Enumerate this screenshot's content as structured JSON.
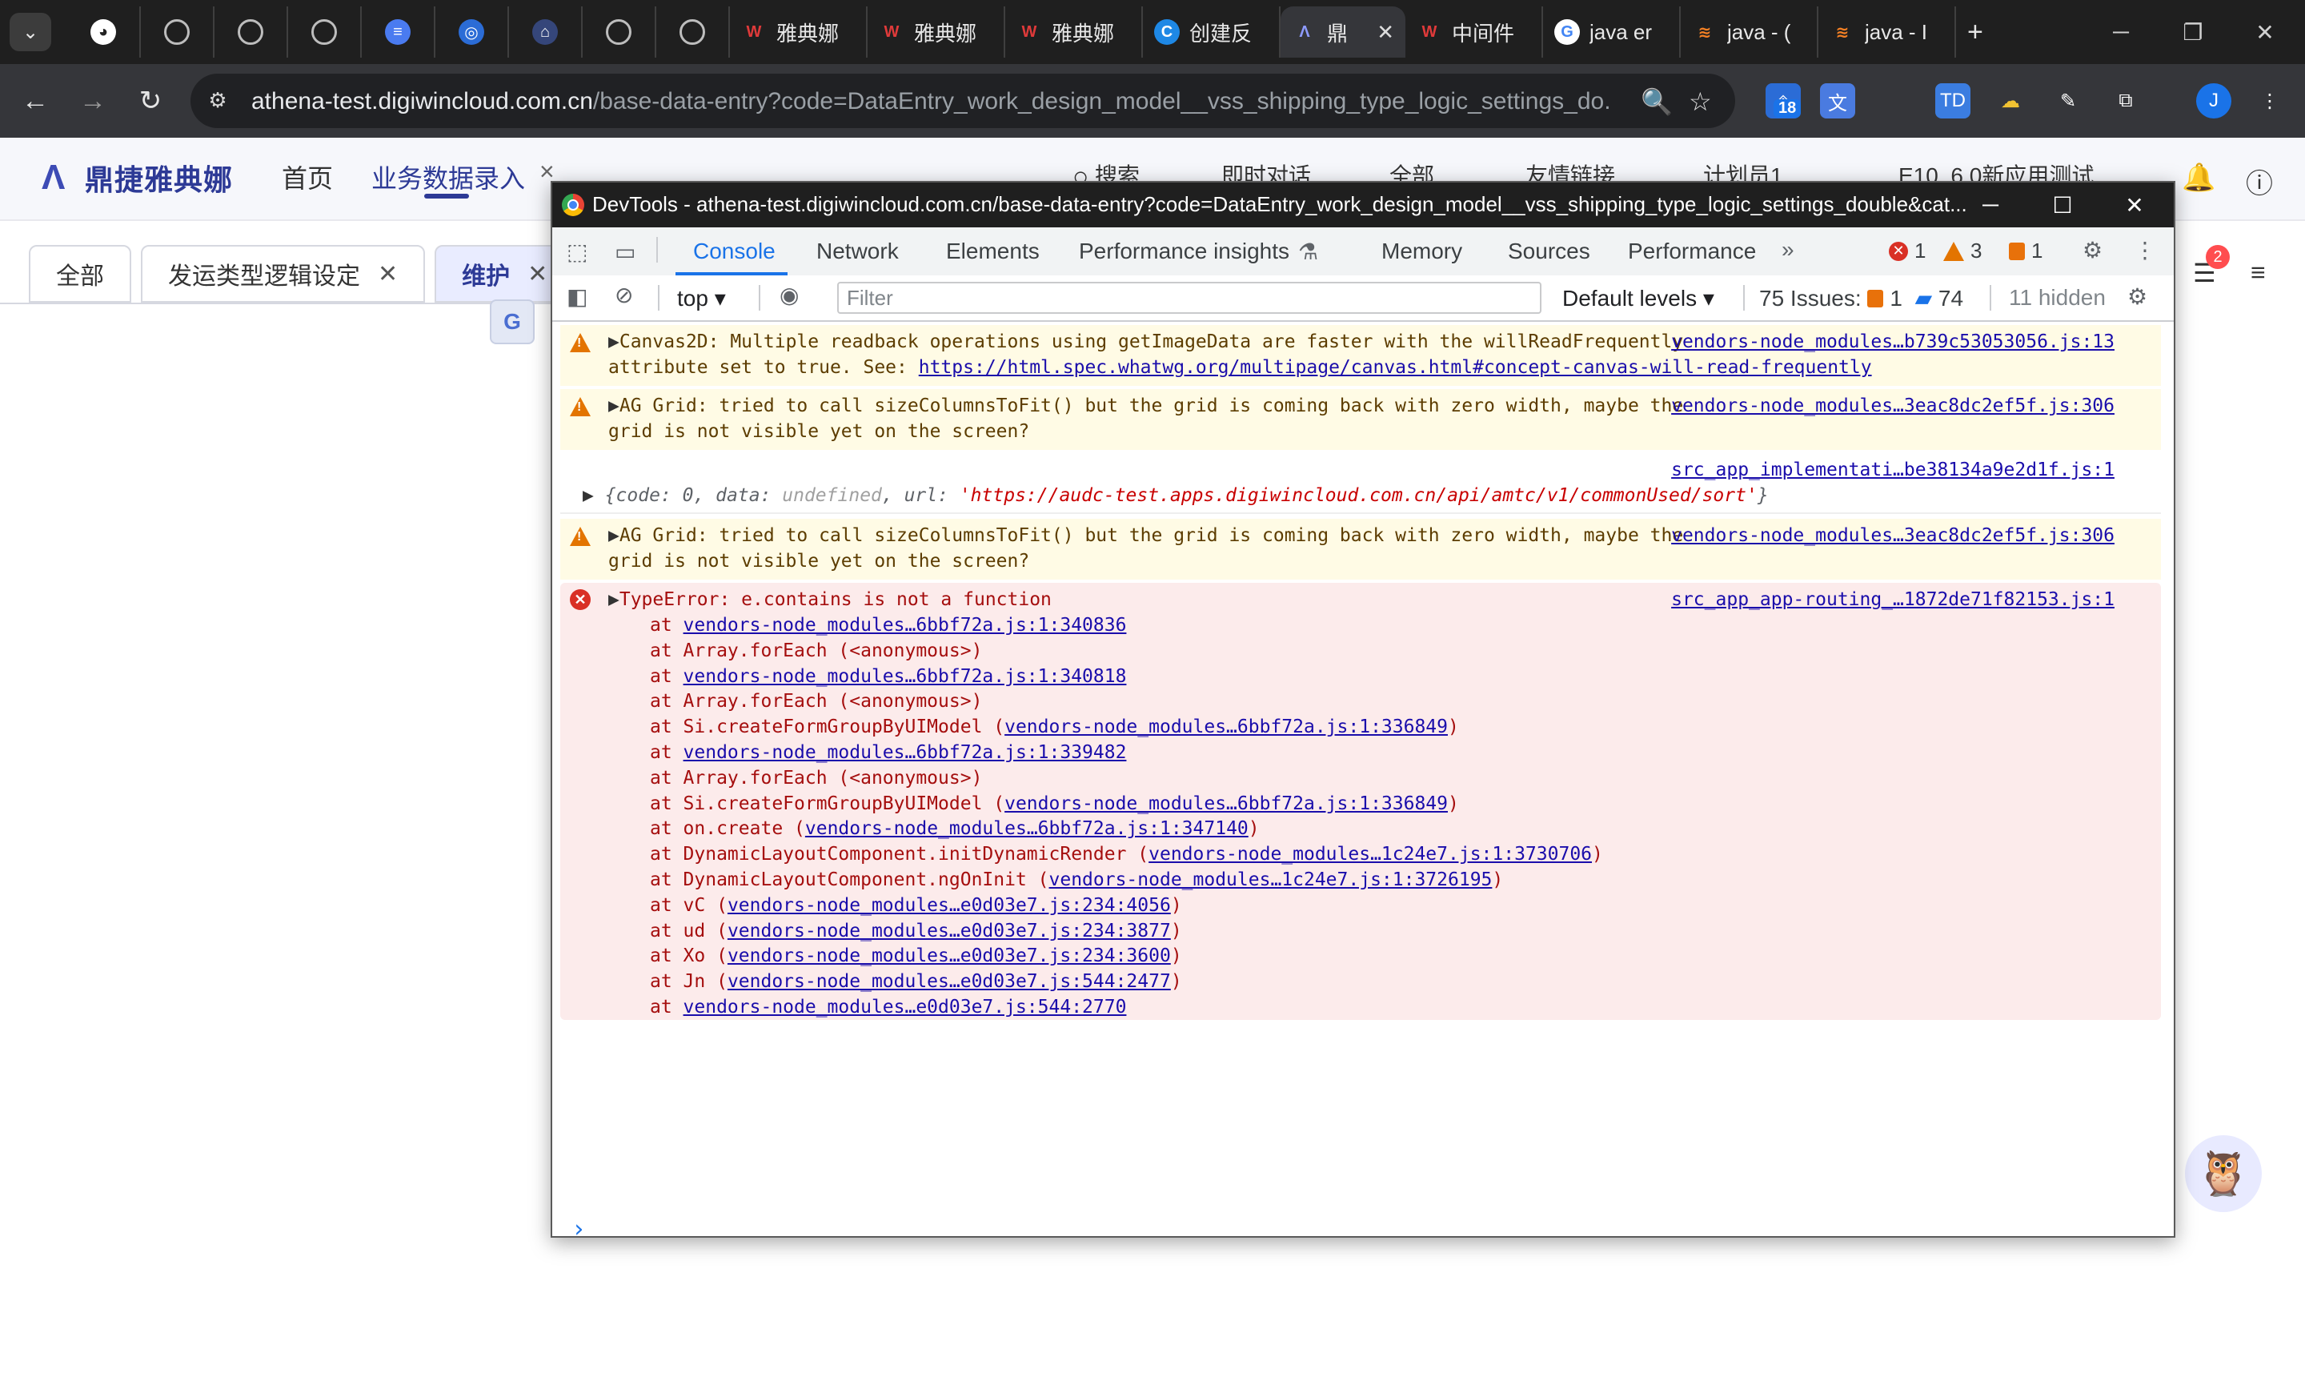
{
  "browser": {
    "tabs": [
      {
        "icon": "ai-icon",
        "title": ""
      },
      {
        "icon": "globe-icon",
        "title": ""
      },
      {
        "icon": "globe-icon",
        "title": ""
      },
      {
        "icon": "globe-icon",
        "title": ""
      },
      {
        "icon": "doc-icon",
        "title": ""
      },
      {
        "icon": "wifi-icon",
        "title": ""
      },
      {
        "icon": "app-icon",
        "title": ""
      },
      {
        "icon": "globe-icon",
        "title": ""
      },
      {
        "icon": "globe-icon",
        "title": ""
      },
      {
        "icon": "yadian-icon",
        "title": "雅典娜"
      },
      {
        "icon": "yadian-icon",
        "title": "雅典娜"
      },
      {
        "icon": "yadian-icon",
        "title": "雅典娜"
      },
      {
        "icon": "create-icon",
        "title": "创建反"
      },
      {
        "icon": "athena-icon",
        "title": "鼎",
        "active": true
      },
      {
        "icon": "yadian-icon",
        "title": "中间件"
      },
      {
        "icon": "google-icon",
        "title": "java er"
      },
      {
        "icon": "stack-icon",
        "title": "java - ("
      },
      {
        "icon": "stack-icon",
        "title": "java - I"
      }
    ],
    "new_tab": "+",
    "url_host": "athena-test.digiwincloud.com.cn",
    "url_path": "/base-data-entry?code=DataEntry_work_design_model__vss_shipping_type_logic_settings_do...",
    "ext_badge": "18",
    "profile_initial": "J"
  },
  "app": {
    "logo_text": "鼎捷雅典娜",
    "nav": [
      "首页",
      "业务数据录入"
    ],
    "nav_close": "×",
    "header_right": [
      "搜索",
      "即时对话",
      "全部",
      "友情链接",
      "计划员1",
      "E10_6.0新应用测试"
    ],
    "page_tabs": [
      {
        "label": "全部",
        "closable": false
      },
      {
        "label": "发运类型逻辑设定",
        "closable": true
      },
      {
        "label": "维护",
        "closable": true,
        "active": true
      }
    ],
    "translate_icon_text": "G",
    "notification_badge": "2"
  },
  "devtools": {
    "title": "DevTools - athena-test.digiwincloud.com.cn/base-data-entry?code=DataEntry_work_design_model__vss_shipping_type_logic_settings_double&cat...",
    "tabs": [
      "Console",
      "Network",
      "Elements",
      "Performance insights",
      "Memory",
      "Sources",
      "Performance"
    ],
    "counts": {
      "errors": "1",
      "warnings": "3",
      "issues": "1"
    },
    "context": "top",
    "filter_placeholder": "Filter",
    "levels": "Default levels",
    "issues_label": "75 Issues:",
    "issues_counts": {
      "warn": "1",
      "info": "74"
    },
    "hidden": "11 hidden",
    "messages": {
      "m1": {
        "line1": "Canvas2D: Multiple readback operations using getImageData are faster with the willReadFrequently",
        "line2_pre": "attribute set to true. See: ",
        "line2_link": "https://html.spec.whatwg.org/multipage/canvas.html#concept-canvas-will-read-frequently",
        "src": "vendors-node_modules…b739c53053056.js:13"
      },
      "m2": {
        "line1": "AG Grid: tried to call sizeColumnsToFit() but the grid is coming back with zero width, maybe the",
        "line2": "grid is not visible yet on the screen?",
        "src": "vendors-node_modules…3eac8dc2ef5f.js:306"
      },
      "m3": {
        "src": "src_app_implementati…be38134a9e2d1f.js:1",
        "obj_pre": "{code: 0, data: ",
        "obj_undef": "undefined",
        "obj_mid": ", url: ",
        "obj_url": "'https://audc-test.apps.digiwincloud.com.cn/api/amtc/v1/commonUsed/sort'",
        "obj_end": "}"
      },
      "m4": {
        "line1": "AG Grid: tried to call sizeColumnsToFit() but the grid is coming back with zero width, maybe the",
        "line2": "grid is not visible yet on the screen?",
        "src": "vendors-node_modules…3eac8dc2ef5f.js:306"
      },
      "m5": {
        "line1": "TypeError: e.contains is not a function",
        "src": "src_app_app-routing_…1872de71f82153.js:1",
        "stack": [
          {
            "pre": "at ",
            "link": "vendors-node_modules…6bbf72a.js:1:340836",
            "post": ""
          },
          {
            "pre": "at Array.forEach (<anonymous>)",
            "link": "",
            "post": ""
          },
          {
            "pre": "at ",
            "link": "vendors-node_modules…6bbf72a.js:1:340818",
            "post": ""
          },
          {
            "pre": "at Array.forEach (<anonymous>)",
            "link": "",
            "post": ""
          },
          {
            "pre": "at Si.createFormGroupByUIModel (",
            "link": "vendors-node_modules…6bbf72a.js:1:336849",
            "post": ")"
          },
          {
            "pre": "at ",
            "link": "vendors-node_modules…6bbf72a.js:1:339482",
            "post": ""
          },
          {
            "pre": "at Array.forEach (<anonymous>)",
            "link": "",
            "post": ""
          },
          {
            "pre": "at Si.createFormGroupByUIModel (",
            "link": "vendors-node_modules…6bbf72a.js:1:336849",
            "post": ")"
          },
          {
            "pre": "at on.create (",
            "link": "vendors-node_modules…6bbf72a.js:1:347140",
            "post": ")"
          },
          {
            "pre": "at DynamicLayoutComponent.initDynamicRender (",
            "link": "vendors-node_modules…1c24e7.js:1:3730706",
            "post": ")"
          },
          {
            "pre": "at DynamicLayoutComponent.ngOnInit (",
            "link": "vendors-node_modules…1c24e7.js:1:3726195",
            "post": ")"
          },
          {
            "pre": "at vC (",
            "link": "vendors-node_modules…e0d03e7.js:234:4056",
            "post": ")"
          },
          {
            "pre": "at ud (",
            "link": "vendors-node_modules…e0d03e7.js:234:3877",
            "post": ")"
          },
          {
            "pre": "at Xo (",
            "link": "vendors-node_modules…e0d03e7.js:234:3600",
            "post": ")"
          },
          {
            "pre": "at Jn (",
            "link": "vendors-node_modules…e0d03e7.js:544:2477",
            "post": ")"
          },
          {
            "pre": "at ",
            "link": "vendors-node_modules…e0d03e7.js:544:2770",
            "post": ""
          }
        ]
      }
    },
    "prompt": "›"
  },
  "colors": {
    "accent": "#2d3a96",
    "devtools_blue": "#1a73e8",
    "error": "#d93025",
    "warning": "#e37400"
  }
}
